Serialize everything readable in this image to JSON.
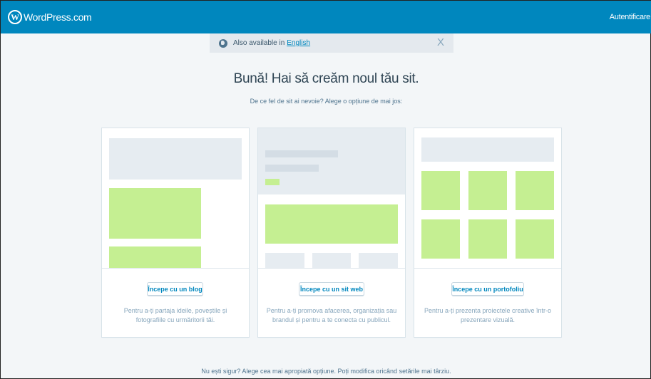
{
  "header": {
    "brand": "WordPress.com",
    "logo_letter": "W",
    "login": "Autentificare",
    "color": "#0087be"
  },
  "notice": {
    "text": "Also available in",
    "link": "English",
    "close": "X"
  },
  "main": {
    "title": "Bună! Hai să creăm noul tău sit.",
    "subtitle": "De ce fel de sit ai nevoie? Alege o opțiune de mai jos:"
  },
  "cards": [
    {
      "button": "Începe cu un blog",
      "description": "Pentru a-ți partaja ideile, poveștile și fotografiile cu urmăritorii tăi."
    },
    {
      "button": "Începe cu un sit web",
      "description": "Pentru a-ți promova afacerea, organizația sau brandul și pentru a te conecta cu publicul."
    },
    {
      "button": "Începe cu un portofoliu",
      "description": "Pentru a-ți prezenta proiectele creative într-o prezentare vizuală."
    }
  ],
  "footer": {
    "text": "Nu ești sigur? Alege cea mai apropiată opțiune. Poți modifica oricând setările mai târziu."
  },
  "colors": {
    "accent_green": "#c5ef92",
    "placeholder_gray": "#e6ecf1",
    "background": "#f3f6f8"
  }
}
